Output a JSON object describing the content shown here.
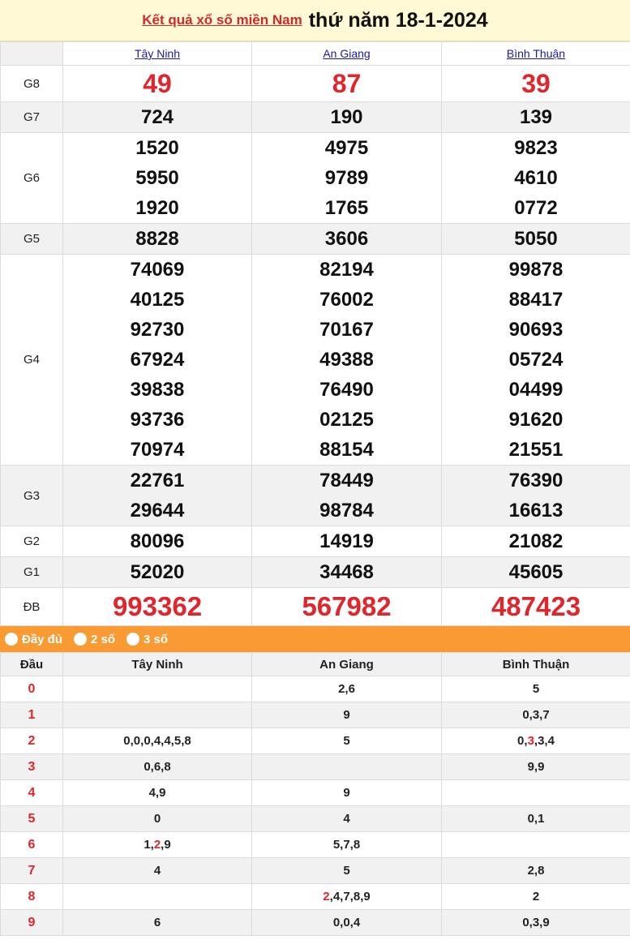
{
  "header": {
    "link_text": "Kết quả xổ số miền Nam",
    "date_text": "thứ năm 18-1-2024"
  },
  "provinces": [
    "Tây Ninh",
    "An Giang",
    "Bình Thuận"
  ],
  "prizes": [
    {
      "label": "G8",
      "values": [
        [
          "49"
        ],
        [
          "87"
        ],
        [
          "39"
        ]
      ]
    },
    {
      "label": "G7",
      "values": [
        [
          "724"
        ],
        [
          "190"
        ],
        [
          "139"
        ]
      ]
    },
    {
      "label": "G6",
      "values": [
        [
          "1520",
          "5950",
          "1920"
        ],
        [
          "4975",
          "9789",
          "1765"
        ],
        [
          "9823",
          "4610",
          "0772"
        ]
      ]
    },
    {
      "label": "G5",
      "values": [
        [
          "8828"
        ],
        [
          "3606"
        ],
        [
          "5050"
        ]
      ]
    },
    {
      "label": "G4",
      "values": [
        [
          "74069",
          "40125",
          "92730",
          "67924",
          "39838",
          "93736",
          "70974"
        ],
        [
          "82194",
          "76002",
          "70167",
          "49388",
          "76490",
          "02125",
          "88154"
        ],
        [
          "99878",
          "88417",
          "90693",
          "05724",
          "04499",
          "91620",
          "21551"
        ]
      ]
    },
    {
      "label": "G3",
      "values": [
        [
          "22761",
          "29644"
        ],
        [
          "78449",
          "98784"
        ],
        [
          "76390",
          "16613"
        ]
      ]
    },
    {
      "label": "G2",
      "values": [
        [
          "80096"
        ],
        [
          "14919"
        ],
        [
          "21082"
        ]
      ]
    },
    {
      "label": "G1",
      "values": [
        [
          "52020"
        ],
        [
          "34468"
        ],
        [
          "45605"
        ]
      ]
    },
    {
      "label": "ĐB",
      "values": [
        [
          "993362"
        ],
        [
          "567982"
        ],
        [
          "487423"
        ]
      ]
    }
  ],
  "options": [
    "Đầy đủ",
    "2 số",
    "3 số"
  ],
  "dau_table": {
    "header": "Đầu",
    "rows": [
      {
        "head": "0",
        "cols": [
          "",
          "2,6",
          "5"
        ]
      },
      {
        "head": "1",
        "cols": [
          "",
          "9",
          "0,3,7"
        ]
      },
      {
        "head": "2",
        "cols": [
          "0,0,0,4,4,5,8",
          "5",
          "0,3,3,4"
        ]
      },
      {
        "head": "3",
        "cols": [
          "0,6,8",
          "",
          "9,9"
        ]
      },
      {
        "head": "4",
        "cols": [
          "4,9",
          "9",
          ""
        ]
      },
      {
        "head": "5",
        "cols": [
          "0",
          "4",
          "0,1"
        ]
      },
      {
        "head": "6",
        "cols": [
          "1,2,9",
          "5,7,8",
          ""
        ]
      },
      {
        "head": "7",
        "cols": [
          "4",
          "5",
          "2,8"
        ]
      },
      {
        "head": "8",
        "cols": [
          "",
          "2,4,7,8,9",
          "2"
        ]
      },
      {
        "head": "9",
        "cols": [
          "6",
          "0,0,4",
          "0,3,9"
        ]
      }
    ],
    "highlights": [
      {
        "row": 2,
        "col": 2,
        "index": 1
      },
      {
        "row": 6,
        "col": 0,
        "index": 1
      },
      {
        "row": 8,
        "col": 1,
        "index": 0
      }
    ]
  },
  "colors": {
    "accent_red": "#e0252b",
    "option_bar": "#fa9a32",
    "header_bg": "#fff9d6",
    "province_link": "#1a1aa6"
  }
}
